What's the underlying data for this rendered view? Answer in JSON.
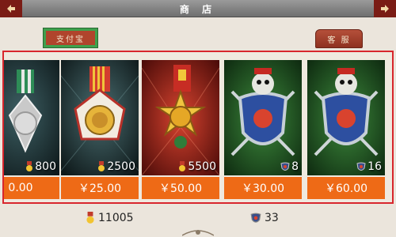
{
  "header": {
    "title": "商 店"
  },
  "tabs": {
    "alipay_label": "支付宝",
    "client_label": "客 服"
  },
  "products": [
    {
      "amount": "800",
      "currency_icon": "medal-icon",
      "price": "0.00",
      "art": "ribbon-medal-partial"
    },
    {
      "amount": "2500",
      "currency_icon": "medal-icon",
      "price": "￥25.00",
      "art": "ribbon-medal"
    },
    {
      "amount": "5500",
      "currency_icon": "medal-icon",
      "price": "￥50.00",
      "art": "gold-star-medal"
    },
    {
      "amount": "8",
      "currency_icon": "shield-icon",
      "price": "￥30.00",
      "art": "skull-shield"
    },
    {
      "amount": "16",
      "currency_icon": "shield-icon",
      "price": "￥60.00",
      "art": "skull-shield"
    }
  ],
  "balances": {
    "gold": "11005",
    "shield": "33"
  },
  "colors": {
    "price_bg": "#ee6a16",
    "frame_border": "#d8262d",
    "tab_selected_border": "#3fa04c"
  }
}
